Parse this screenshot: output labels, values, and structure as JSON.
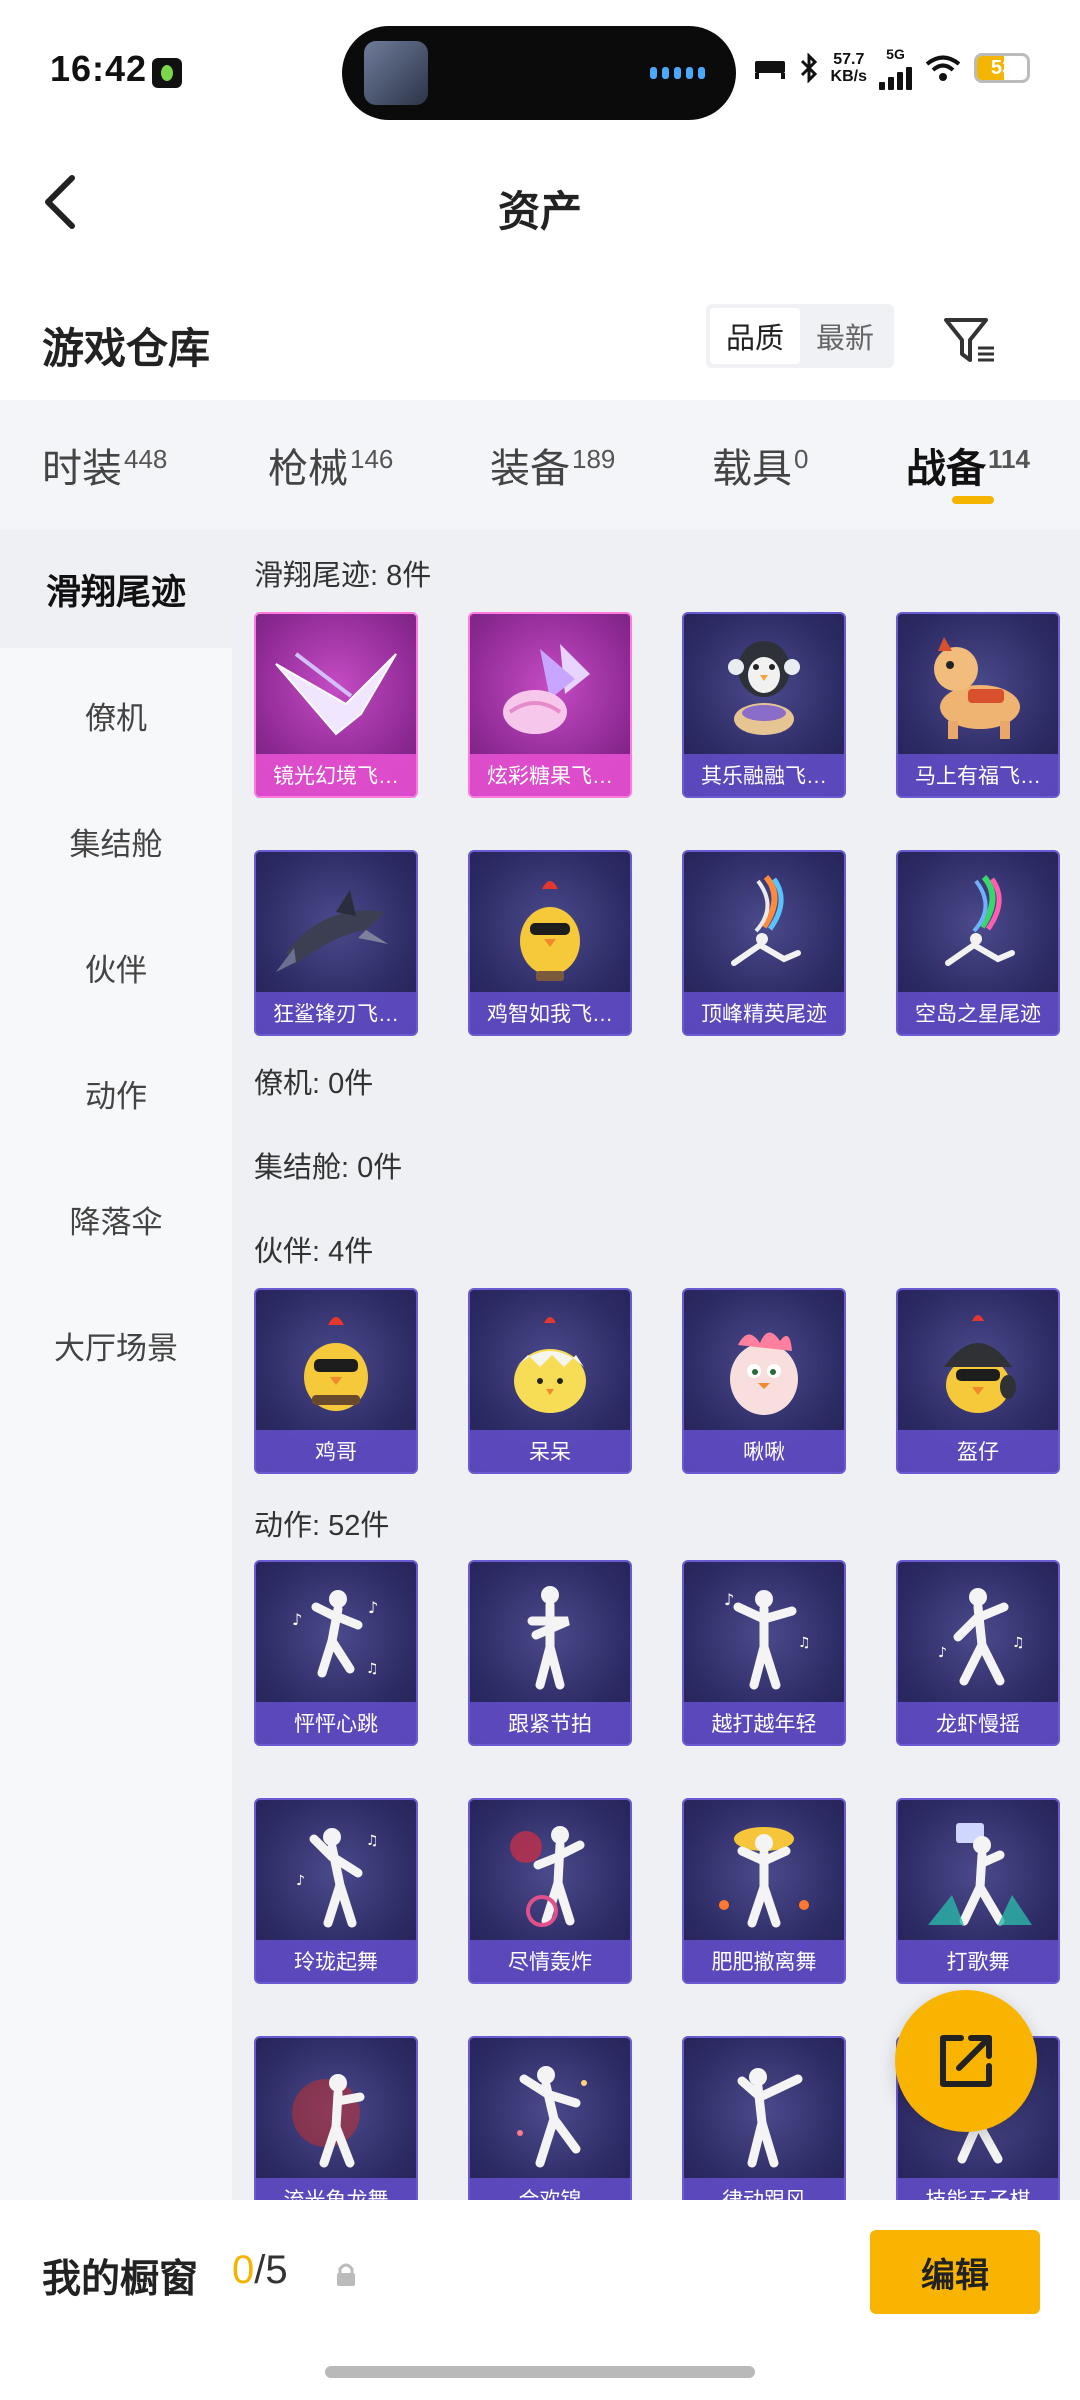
{
  "status_bar": {
    "time": "16:42",
    "network_speed": "57.7",
    "network_unit": "KB/s",
    "signal_label": "5G",
    "battery": "53"
  },
  "nav": {
    "title": "资产"
  },
  "header": {
    "section_title": "游戏仓库",
    "sort_options": [
      "品质",
      "最新"
    ],
    "sort_selected": "品质"
  },
  "tabs": [
    {
      "label": "时装",
      "count": "448"
    },
    {
      "label": "枪械",
      "count": "146"
    },
    {
      "label": "装备",
      "count": "189"
    },
    {
      "label": "载具",
      "count": "0"
    },
    {
      "label": "战备",
      "count": "114"
    }
  ],
  "tab_selected": "战备",
  "sidebar": {
    "items": [
      "滑翔尾迹",
      "僚机",
      "集结舱",
      "伙伴",
      "动作",
      "降落伞",
      "大厅场景"
    ],
    "selected": "滑翔尾迹"
  },
  "groups": {
    "glide": {
      "label": "滑翔尾迹: 8件",
      "items": [
        "镜光幻境飞…",
        "炫彩糖果飞…",
        "其乐融融飞…",
        "马上有福飞…",
        "狂鲨锋刃飞…",
        "鸡智如我飞…",
        "顶峰精英尾迹",
        "空岛之星尾迹"
      ]
    },
    "wingman": {
      "label": "僚机: 0件"
    },
    "rally": {
      "label": "集结舱: 0件"
    },
    "partner": {
      "label": "伙伴: 4件",
      "items": [
        "鸡哥",
        "呆呆",
        "啾啾",
        "盔仔"
      ]
    },
    "emote": {
      "label": "动作: 52件",
      "items": [
        "怦怦心跳",
        "跟紧节拍",
        "越打越年轻",
        "龙虾慢摇",
        "玲珑起舞",
        "尽情轰炸",
        "肥肥撤离舞",
        "打歌舞",
        "流光魚龙舞",
        "合欢锦",
        "律动跟风",
        "技能五子棋"
      ]
    }
  },
  "bottom": {
    "label": "我的橱窗",
    "used": "0",
    "total": "/5",
    "edit_label": "编辑"
  },
  "colors": {
    "accent": "#f8b400",
    "card_bg": "#2c2a63",
    "card_caption": "#5f4cc4",
    "card_pink": "#c54cc4"
  }
}
